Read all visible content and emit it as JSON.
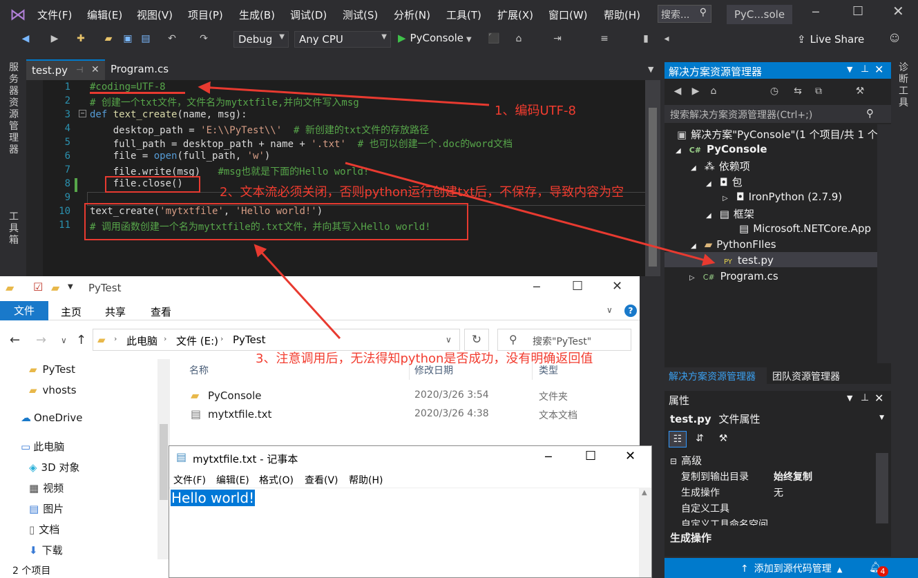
{
  "menu": [
    "文件(F)",
    "编辑(E)",
    "视图(V)",
    "项目(P)",
    "生成(B)",
    "调试(D)",
    "测试(S)",
    "分析(N)",
    "工具(T)",
    "扩展(X)",
    "窗口(W)",
    "帮助(H)"
  ],
  "search_placeholder": "搜索...",
  "window_title": "PyC...sole",
  "toolbar": {
    "config": "Debug",
    "platform": "Any CPU",
    "run": "PyConsole",
    "live_share": "Live Share"
  },
  "side_left": [
    "服务器资源管理器",
    "工具箱"
  ],
  "side_right": "诊断工具",
  "tabs": [
    "test.py",
    "Program.cs"
  ],
  "code": {
    "lines": [
      "1",
      "2",
      "3",
      "4",
      "5",
      "6",
      "7",
      "8",
      "9",
      "10",
      "11"
    ],
    "l1": "#coding=UTF-8",
    "l2": "# 创建一个txt文件，文件名为mytxtfile,并向文件写入msg",
    "l3a": "def ",
    "l3b": "text_create",
    "l3c": "(name, msg):",
    "l4a": "    desktop_path = ",
    "l4b": "'E:\\\\PyTest\\\\'",
    "l4c": "  # 新创建的txt文件的存放路径",
    "l5a": "    full_path = desktop_path + name + ",
    "l5b": "'.txt'",
    "l5c": "  # 也可以创建一个.doc的word文档",
    "l6a": "    file = ",
    "l6b": "open",
    "l6c": "(full_path, ",
    "l6d": "'w'",
    "l6e": ")",
    "l7a": "    file.write(msg)",
    "l7b": "   #msg也就是下面的Hello world!",
    "l8": "    file.close()",
    "l10a": "text_create(",
    "l10b": "'mytxtfile'",
    "l10c": ", ",
    "l10d": "'Hello world!'",
    "l10e": ")",
    "l11": "# 调用函数创建一个名为mytxtfile的.txt文件，并向其写入Hello world!"
  },
  "annotations": {
    "a1": "1、编码UTF-8",
    "a2": "2、文本流必须关闭，否则python运行创建txt后，不保存，导致内容为空",
    "a3": "3、注意调用后，无法得知python是否成功，没有明确返回值"
  },
  "solution": {
    "title": "解决方案资源管理器",
    "search": "搜索解决方案资源管理器(Ctrl+;)",
    "items": [
      "解决方案\"PyConsole\"(1 个项目/共 1 个)",
      "PyConsole",
      "依赖项",
      "包",
      "IronPython (2.7.9)",
      "框架",
      "Microsoft.NETCore.App",
      "PythonFIles",
      "test.py",
      "Program.cs"
    ],
    "bottom_tabs": [
      "解决方案资源管理器",
      "团队资源管理器"
    ]
  },
  "properties": {
    "title": "属性",
    "subject": "test.py",
    "subject_type": "文件属性",
    "section": "高级",
    "rows": [
      [
        "复制到输出目录",
        "始终复制"
      ],
      [
        "生成操作",
        "无"
      ],
      [
        "自定义工具",
        ""
      ],
      [
        "自定义工具命名空间",
        ""
      ]
    ],
    "desc_title": "生成操作"
  },
  "explorer": {
    "title": "PyTest",
    "ribbon": [
      "文件",
      "主页",
      "共享",
      "查看"
    ],
    "crumbs": [
      "此电脑",
      "文件 (E:)",
      "PyTest"
    ],
    "search": "搜索\"PyTest\"",
    "nav": [
      "PyTest",
      "vhosts",
      "OneDrive",
      "此电脑",
      "3D 对象",
      "视频",
      "图片",
      "文档",
      "下载"
    ],
    "cols": [
      "名称",
      "修改日期",
      "类型"
    ],
    "files": [
      [
        "PyConsole",
        "2020/3/26 3:54",
        "文件夹"
      ],
      [
        "mytxtfile.txt",
        "2020/3/26 4:38",
        "文本文档"
      ]
    ],
    "count": "2 个项目"
  },
  "notepad": {
    "title": "mytxtfile.txt - 记事本",
    "menu": [
      "文件(F)",
      "编辑(E)",
      "格式(O)",
      "查看(V)",
      "帮助(H)"
    ],
    "content": "Hello world!"
  },
  "status": {
    "source": "添加到源代码管理",
    "notif": "4"
  },
  "colors": {
    "accent": "#007acc",
    "annotation": "#e83a30",
    "editor_bg": "#1e1e1e",
    "comment": "#57a64a"
  }
}
